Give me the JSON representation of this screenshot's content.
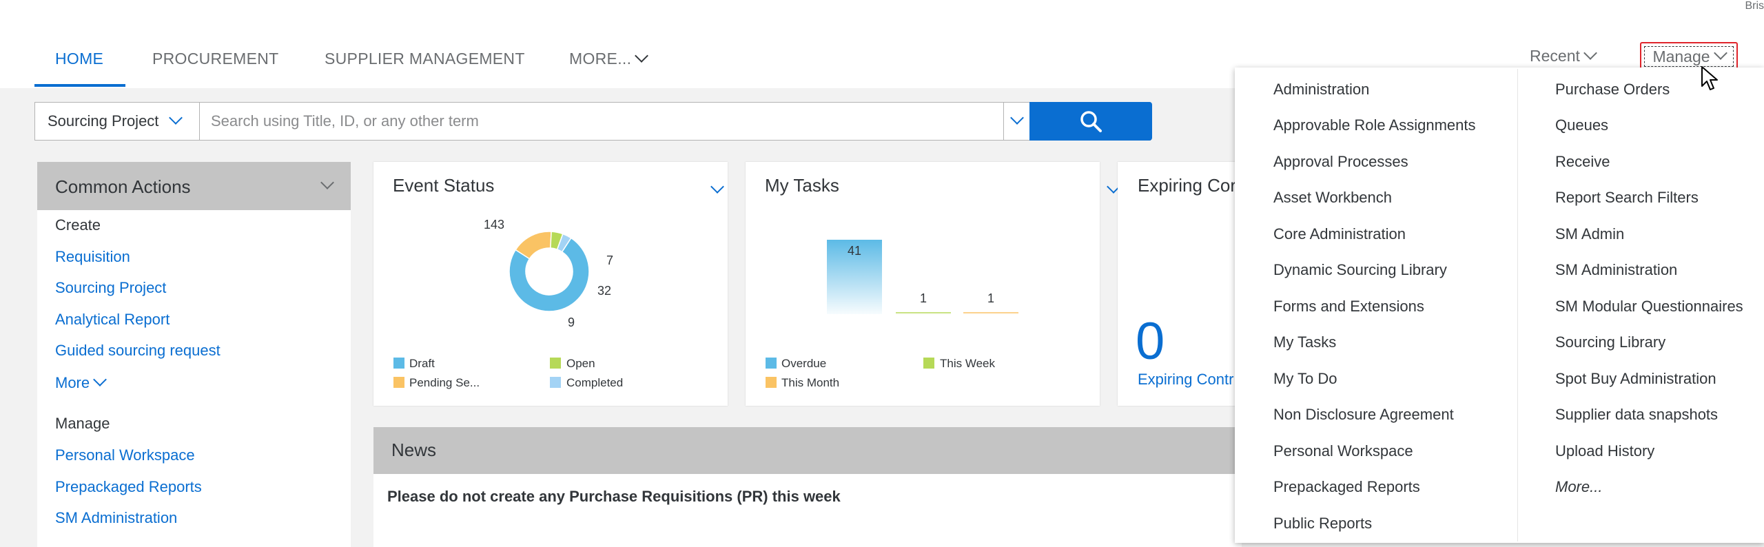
{
  "header": {
    "user_name": "Bris",
    "nav_tabs": [
      {
        "label": "HOME",
        "active": true
      },
      {
        "label": "PROCUREMENT",
        "active": false
      },
      {
        "label": "SUPPLIER MANAGEMENT",
        "active": false
      },
      {
        "label": "MORE...",
        "active": false
      }
    ],
    "recent_label": "Recent",
    "manage_label": "Manage"
  },
  "search": {
    "scope": "Sourcing Project",
    "placeholder": "Search using Title, ID, or any other term"
  },
  "common_actions": {
    "title": "Common Actions",
    "create_label": "Create",
    "create_items": [
      "Requisition",
      "Sourcing Project",
      "Analytical Report",
      "Guided sourcing request"
    ],
    "more_label": "More",
    "manage_label": "Manage",
    "manage_items": [
      "Personal Workspace",
      "Prepackaged Reports",
      "SM Administration"
    ]
  },
  "tiles": {
    "event_status": {
      "title": "Event Status",
      "legend": [
        "Draft",
        "Open",
        "Pending Se...",
        "Completed"
      ]
    },
    "my_tasks": {
      "title": "My Tasks",
      "legend": [
        "Overdue",
        "This Week",
        "This Month"
      ]
    },
    "expiring": {
      "title": "Expiring Cor",
      "count": "0",
      "link": "Expiring Contr"
    }
  },
  "chart_data": [
    {
      "type": "pie",
      "title": "Event Status",
      "categories": [
        "Draft",
        "Pending Se...",
        "Open",
        "Completed"
      ],
      "values": [
        143,
        32,
        9,
        7
      ],
      "labels": [
        "143",
        "32",
        "9",
        "7"
      ],
      "colors": [
        "#5cbae6",
        "#fac364",
        "#b6d957",
        "#a3d3f5"
      ]
    },
    {
      "type": "bar",
      "title": "My Tasks",
      "categories": [
        "Overdue",
        "This Week",
        "This Month"
      ],
      "values": [
        41,
        1,
        1
      ],
      "labels": [
        "41",
        "1",
        "1"
      ],
      "colors": [
        "#5cbae6",
        "#b6d957",
        "#fac364"
      ]
    }
  ],
  "news": {
    "title": "News",
    "message": "Please do not create any Purchase Requisitions (PR) this week"
  },
  "manage_menu": {
    "left_column": [
      "Administration",
      "Approvable Role Assignments",
      "Approval Processes",
      "Asset Workbench",
      "Core Administration",
      "Dynamic Sourcing Library",
      "Forms and Extensions",
      "My Tasks",
      "My To Do",
      "Non Disclosure Agreement",
      "Personal Workspace",
      "Prepackaged Reports",
      "Public Reports"
    ],
    "right_column": [
      "Purchase Orders",
      "Queues",
      "Receive",
      "Report Search Filters",
      "SM Admin",
      "SM Administration",
      "SM Modular Questionnaires",
      "Sourcing Library",
      "Spot Buy Administration",
      "Supplier data snapshots",
      "Upload History"
    ],
    "more_label": "More..."
  },
  "colors": {
    "accent": "#0a6ed1",
    "highlight_border": "#e0242b",
    "panel_header": "#c4c4c4"
  }
}
